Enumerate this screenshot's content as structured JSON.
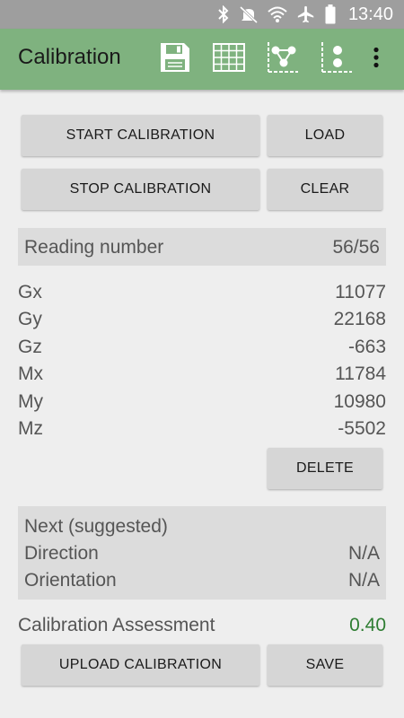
{
  "status_bar": {
    "time": "13:40",
    "icons": [
      "bluetooth-icon",
      "mute-icon",
      "wifi-icon",
      "airplane-icon",
      "battery-icon"
    ]
  },
  "app_bar": {
    "title": "Calibration",
    "background": "#7fb27f",
    "actions": [
      "save-icon",
      "table-icon",
      "graph-icon",
      "scatter-icon",
      "more-vert-icon"
    ]
  },
  "buttons": {
    "start": "START CALIBRATION",
    "load": "LOAD",
    "stop": "STOP CALIBRATION",
    "clear": "CLEAR",
    "delete": "DELETE",
    "upload": "UPLOAD CALIBRATION",
    "save": "SAVE"
  },
  "reading": {
    "label": "Reading number",
    "value": "56/56"
  },
  "sensors": [
    {
      "label": "Gx",
      "value": "11077"
    },
    {
      "label": "Gy",
      "value": "22168"
    },
    {
      "label": "Gz",
      "value": "-663"
    },
    {
      "label": "Mx",
      "value": "11784"
    },
    {
      "label": "My",
      "value": "10980"
    },
    {
      "label": "Mz",
      "value": "-5502"
    }
  ],
  "suggested": {
    "title": "Next (suggested)",
    "direction_label": "Direction",
    "direction_value": "N/A",
    "orientation_label": "Orientation",
    "orientation_value": "N/A"
  },
  "assessment": {
    "label": "Calibration Assessment",
    "value": "0.40",
    "value_color": "#2e7d32"
  }
}
